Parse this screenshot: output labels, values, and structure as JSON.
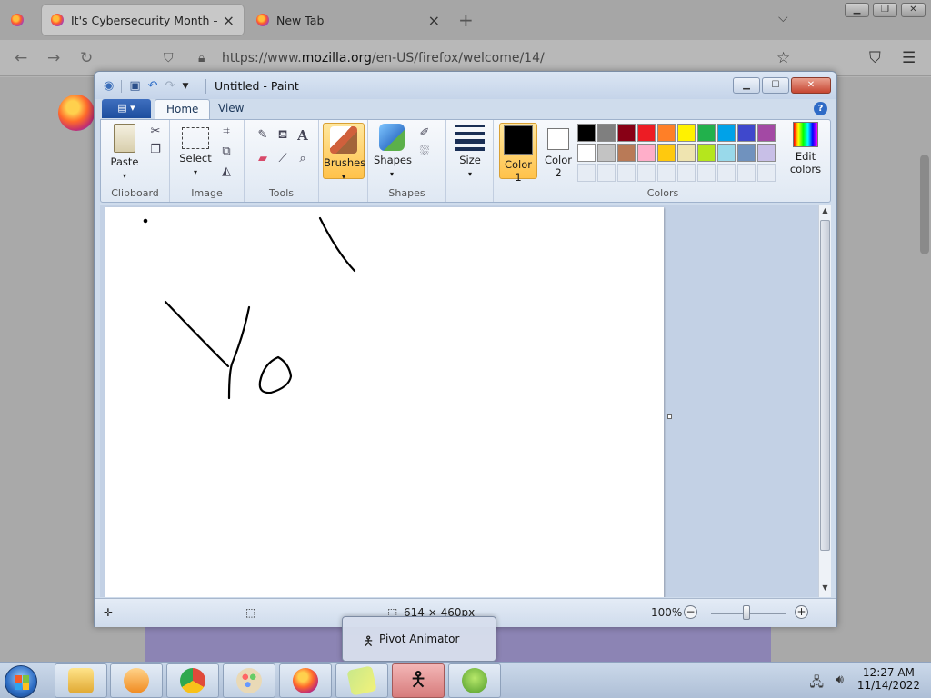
{
  "browser": {
    "tabs": [
      {
        "title": "It's Cybersecurity Month — tim",
        "active": true
      },
      {
        "title": "New Tab",
        "active": false
      }
    ],
    "url_prefix": "https://www.",
    "url_host": "mozilla.org",
    "url_path": "/en-US/firefox/welcome/14/"
  },
  "paint": {
    "window_title": "Untitled - Paint",
    "tabs": [
      "Home",
      "View"
    ],
    "help": "?",
    "groups": {
      "clipboard": {
        "label": "Clipboard",
        "paste": "Paste"
      },
      "image": {
        "label": "Image",
        "select": "Select"
      },
      "tools": {
        "label": "Tools"
      },
      "brushes": {
        "label": "Brushes"
      },
      "shapes": {
        "label": "Shapes",
        "button": "Shapes"
      },
      "size": {
        "label": "Size"
      },
      "colors": {
        "label": "Colors",
        "color1_line1": "Color",
        "color1_line2": "1",
        "color2_line1": "Color",
        "color2_line2": "2",
        "edit_line1": "Edit",
        "edit_line2": "colors",
        "color1_value": "#000000",
        "color2_value": "#ffffff",
        "palette_row1": [
          "#000000",
          "#7f7f7f",
          "#880015",
          "#ed1c24",
          "#ff7f27",
          "#fff200",
          "#22b14c",
          "#00a2e8",
          "#3f48cc",
          "#a349a4"
        ],
        "palette_row2": [
          "#ffffff",
          "#c3c3c3",
          "#b97a57",
          "#ffaec9",
          "#ffc90e",
          "#efe4b0",
          "#b5e61d",
          "#99d9ea",
          "#7092be",
          "#c8bfe7"
        ]
      }
    },
    "status": {
      "dimensions": "614 × 460px",
      "zoom": "100%",
      "zoom_minus": "−",
      "zoom_plus": "+"
    }
  },
  "popup": {
    "label": "Pivot Animator"
  },
  "tray": {
    "time": "12:27 AM",
    "date": "11/14/2022"
  }
}
